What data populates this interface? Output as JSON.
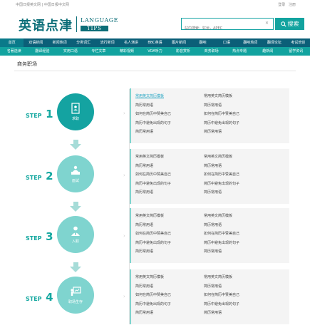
{
  "topbar": {
    "links_left": [
      "中国日报英文网",
      "中国日报中文网"
    ],
    "separator": "|",
    "login": "登录",
    "register": "注册"
  },
  "logo": {
    "cn": "英语点津",
    "en_top": "LANGUAGE",
    "en_bottom": "TIPS"
  },
  "search": {
    "placeholder": "站内搜索：好运，APEC",
    "button_label": "搜索"
  },
  "nav_primary": [
    "首页",
    "双语新闻",
    "新闻热词",
    "分类词汇",
    "流行新词",
    "名人演讲",
    "BBC英语",
    "图片新闻",
    "翻吧",
    "口语",
    "翻吧热词",
    "翻译论坛",
    "考试培训"
  ],
  "nav_secondary": [
    "名著选读",
    "翻译经验",
    "实用口语",
    "专栏文章",
    "精彩视频",
    "VOA听力",
    "影音赏析",
    "商务职场",
    "热点专题",
    "趣新闻",
    "留学资讯"
  ],
  "breadcrumb": "商务职场",
  "steps": [
    {
      "word": "STEP",
      "num": "1",
      "label": "求职",
      "icon": "resume-icon",
      "style": "dark",
      "col1": [
        "常用英文简历模板",
        "简历常用语",
        "如何在简历中赞美自己",
        "简历中避免出现的句子",
        "简历常用语"
      ],
      "col2": [
        "常用英文简历模板",
        "简历常用语",
        "如何在简历中赞美自己",
        "简历中避免出现的句子",
        "简历常用语"
      ],
      "active_item": "常用英文简历模板"
    },
    {
      "word": "STEP",
      "num": "2",
      "label": "面试",
      "icon": "interview-icon",
      "style": "light",
      "col1": [
        "常用英文简历模板",
        "简历常用语",
        "如何在简历中赞美自己",
        "简历中避免出现的句子",
        "简历常用语"
      ],
      "col2": [
        "常用英文简历模板",
        "简历常用语",
        "如何在简历中赞美自己",
        "简历中避免出现的句子",
        "简历常用语"
      ]
    },
    {
      "word": "STEP",
      "num": "3",
      "label": "入职",
      "icon": "employee-icon",
      "style": "light",
      "col1": [
        "常用英文简历模板",
        "简历常用语",
        "如何在简历中赞美自己",
        "简历中避免出现的句子",
        "简历常用语"
      ],
      "col2": [
        "常用英文简历模板",
        "简历常用语",
        "如何在简历中赞美自己",
        "简历中避免出现的句子",
        "简历常用语"
      ]
    },
    {
      "word": "STEP",
      "num": "4",
      "label": "职场生存",
      "icon": "presentation-icon",
      "style": "light",
      "col1": [
        "常用英文简历模板",
        "简历常用语",
        "如何在简历中赞美自己",
        "简历中避免出现的句子",
        "简历常用语"
      ],
      "col2": [
        "常用英文简历模板",
        "简历常用语",
        "如何在简历中赞美自己",
        "简历中避免出现的句子",
        "简历常用语"
      ]
    }
  ],
  "colors": {
    "brand": "#0b6e78",
    "nav_primary_bg": "#0b5f78",
    "nav_secondary_bg": "#12a39f",
    "step_dark": "#14a3a1",
    "step_light": "#7fd4cf",
    "link_active": "#2aa7c4"
  }
}
